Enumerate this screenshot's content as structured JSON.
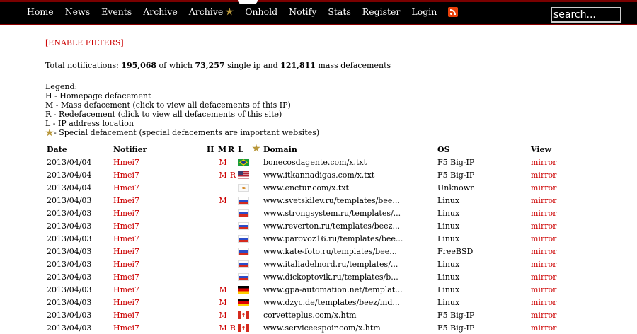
{
  "nav": {
    "items": [
      {
        "label": "Home"
      },
      {
        "label": "News"
      },
      {
        "label": "Events"
      },
      {
        "label": "Archive"
      },
      {
        "label": "Archive",
        "special": true
      },
      {
        "label": "Onhold"
      },
      {
        "label": "Notify"
      },
      {
        "label": "Stats"
      },
      {
        "label": "Register"
      },
      {
        "label": "Login"
      }
    ],
    "rss_icon": "rss-icon",
    "search_placeholder": "search..."
  },
  "filters_link": "[ENABLE FILTERS]",
  "totals": {
    "prefix": "Total notifications: ",
    "total": "195,068",
    "mid1": " of which ",
    "single": "73,257",
    "mid2": " single ip and ",
    "mass": "121,811",
    "suffix": " mass defacements"
  },
  "legend": {
    "title": "Legend:",
    "h": "H - Homepage defacement",
    "m": "M - Mass defacement (click to view all defacements of this IP)",
    "r": "R - Redefacement (click to view all defacements of this site)",
    "l": "L - IP address location",
    "special": " - Special defacement (special defacements are important websites)"
  },
  "table": {
    "headers": {
      "date": "Date",
      "notifier": "Notifier",
      "h": "H",
      "m": "M",
      "r": "R",
      "l": "L",
      "domain": "Domain",
      "os": "OS",
      "view": "View"
    },
    "rows": [
      {
        "date": "2013/04/04",
        "notifier": "Hmei7",
        "h": "",
        "m": "M",
        "r": "",
        "flag": "br",
        "domain": "bonecosdagente.com/x.txt",
        "os": "F5 Big-IP",
        "view": "mirror"
      },
      {
        "date": "2013/04/04",
        "notifier": "Hmei7",
        "h": "",
        "m": "M",
        "r": "R",
        "flag": "us",
        "domain": "www.itkannadigas.com/x.txt",
        "os": "F5 Big-IP",
        "view": "mirror"
      },
      {
        "date": "2013/04/04",
        "notifier": "Hmei7",
        "h": "",
        "m": "",
        "r": "",
        "flag": "cy",
        "domain": "www.enctur.com/x.txt",
        "os": "Unknown",
        "view": "mirror"
      },
      {
        "date": "2013/04/03",
        "notifier": "Hmei7",
        "h": "",
        "m": "M",
        "r": "",
        "flag": "ru",
        "domain": "www.svetskilev.ru/templates/bee...",
        "os": "Linux",
        "view": "mirror"
      },
      {
        "date": "2013/04/03",
        "notifier": "Hmei7",
        "h": "",
        "m": "",
        "r": "",
        "flag": "ru",
        "domain": "www.strongsystem.ru/templates/...",
        "os": "Linux",
        "view": "mirror"
      },
      {
        "date": "2013/04/03",
        "notifier": "Hmei7",
        "h": "",
        "m": "",
        "r": "",
        "flag": "ru",
        "domain": "www.reverton.ru/templates/beez...",
        "os": "Linux",
        "view": "mirror"
      },
      {
        "date": "2013/04/03",
        "notifier": "Hmei7",
        "h": "",
        "m": "",
        "r": "",
        "flag": "ru",
        "domain": "www.parovoz16.ru/templates/bee...",
        "os": "Linux",
        "view": "mirror"
      },
      {
        "date": "2013/04/03",
        "notifier": "Hmei7",
        "h": "",
        "m": "",
        "r": "",
        "flag": "ru",
        "domain": "www.kate-foto.ru/templates/bee...",
        "os": "FreeBSD",
        "view": "mirror"
      },
      {
        "date": "2013/04/03",
        "notifier": "Hmei7",
        "h": "",
        "m": "",
        "r": "",
        "flag": "ru",
        "domain": "www.italiadelnord.ru/templates/...",
        "os": "Linux",
        "view": "mirror"
      },
      {
        "date": "2013/04/03",
        "notifier": "Hmei7",
        "h": "",
        "m": "",
        "r": "",
        "flag": "ru",
        "domain": "www.dickoptovik.ru/templates/b...",
        "os": "Linux",
        "view": "mirror"
      },
      {
        "date": "2013/04/03",
        "notifier": "Hmei7",
        "h": "",
        "m": "M",
        "r": "",
        "flag": "de",
        "domain": "www.gpa-automation.net/templat...",
        "os": "Linux",
        "view": "mirror"
      },
      {
        "date": "2013/04/03",
        "notifier": "Hmei7",
        "h": "",
        "m": "M",
        "r": "",
        "flag": "de",
        "domain": "www.dzyc.de/templates/beez/ind...",
        "os": "Linux",
        "view": "mirror"
      },
      {
        "date": "2013/04/03",
        "notifier": "Hmei7",
        "h": "",
        "m": "M",
        "r": "",
        "flag": "ca",
        "domain": "corvetteplus.com/x.htm",
        "os": "F5 Big-IP",
        "view": "mirror"
      },
      {
        "date": "2013/04/03",
        "notifier": "Hmei7",
        "h": "",
        "m": "M",
        "r": "R",
        "flag": "ca",
        "domain": "www.serviceespoir.com/x.htm",
        "os": "F5 Big-IP",
        "view": "mirror"
      }
    ]
  }
}
